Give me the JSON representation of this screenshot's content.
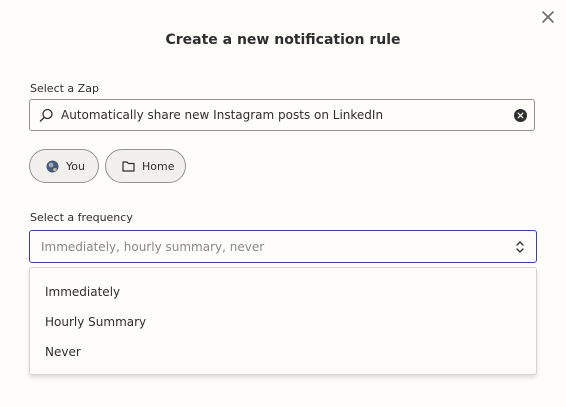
{
  "modal": {
    "title": "Create a new notification rule",
    "close_icon": "close-icon"
  },
  "zap": {
    "label": "Select a Zap",
    "search_icon": "search-icon",
    "value": "Automatically share new Instagram posts on LinkedIn",
    "clear_icon": "clear-circle-icon"
  },
  "chips": [
    {
      "label": "You",
      "icon": "user-avatar-icon"
    },
    {
      "label": "Home",
      "icon": "folder-icon"
    }
  ],
  "frequency": {
    "label": "Select a frequency",
    "placeholder": "Immediately, hourly summary, never",
    "chevron_icon": "chevron-up-down-icon",
    "options": [
      "Immediately",
      "Hourly Summary",
      "Never"
    ]
  },
  "colors": {
    "background": "#fffdf9",
    "text": "#2d2e2e",
    "focus_border": "#3d4592",
    "chip_background": "#f1f0ed"
  }
}
